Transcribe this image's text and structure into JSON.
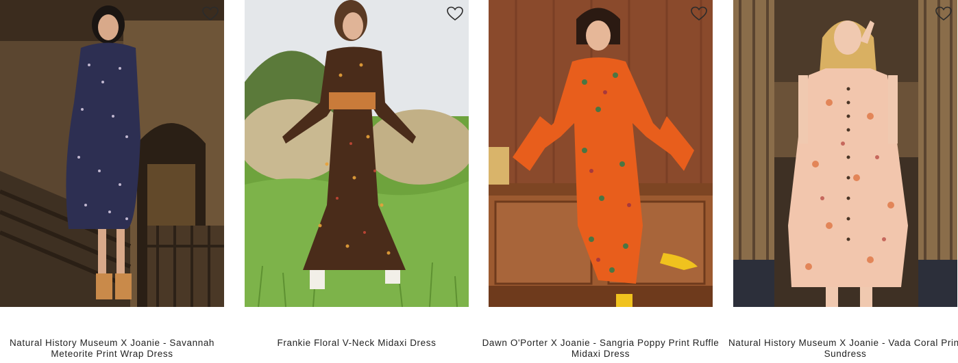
{
  "products": [
    {
      "title": "Natural History Museum X Joanie - Savannah Meteorite Print Wrap Dress",
      "image_alt": "Model wearing a navy ditsy floral print wrap dress on a museum staircase",
      "wishlist_icon": "heart-outline-icon"
    },
    {
      "title": "Frankie Floral V-Neck Midaxi Dress",
      "image_alt": "Model wearing a brown floral long-sleeve midaxi dress in a field with hay bales",
      "wishlist_icon": "heart-outline-icon"
    },
    {
      "title": "Dawn O'Porter X Joanie - Sangria Poppy Print Ruffle Midaxi Dress",
      "image_alt": "Model wearing an orange poppy print ruffle sleeve dress sitting on a wooden sideboard",
      "wishlist_icon": "heart-outline-icon"
    },
    {
      "title": "Natural History Museum X Joanie - Vada Coral Print Sundress",
      "image_alt": "Model wearing a peach coral print sundress in a museum hall",
      "wishlist_icon": "heart-outline-icon"
    }
  ],
  "colors": {
    "title_text": "#222222",
    "heart_stroke": "#2b2b2b"
  }
}
